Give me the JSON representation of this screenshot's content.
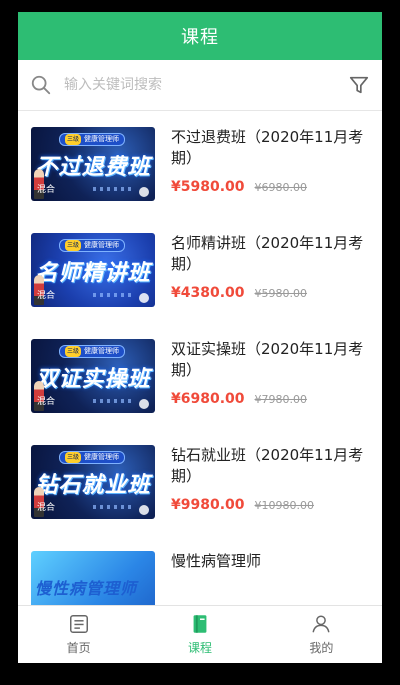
{
  "header": {
    "title": "课程"
  },
  "search": {
    "placeholder": "输入关键词搜索",
    "value": ""
  },
  "courses": [
    {
      "title": "不过退费班（2020年11月考期）",
      "price": "¥5980.00",
      "original_price": "¥6980.00",
      "thumb": {
        "badge_tag": "三级",
        "badge": "健康管理师",
        "big": "不过退费班",
        "mix": "混合"
      }
    },
    {
      "title": "名师精讲班（2020年11月考期）",
      "price": "¥4380.00",
      "original_price": "¥5980.00",
      "thumb": {
        "badge_tag": "三级",
        "badge": "健康管理师",
        "big": "名师精讲班",
        "mix": "混合"
      }
    },
    {
      "title": "双证实操班（2020年11月考期）",
      "price": "¥6980.00",
      "original_price": "¥7980.00",
      "thumb": {
        "badge_tag": "三级",
        "badge": "健康管理师",
        "big": "双证实操班",
        "mix": "混合"
      }
    },
    {
      "title": "钻石就业班（2020年11月考期）",
      "price": "¥9980.00",
      "original_price": "¥10980.00",
      "thumb": {
        "badge_tag": "三级",
        "badge": "健康管理师",
        "big": "钻石就业班",
        "mix": "混合"
      }
    },
    {
      "title": "慢性病管理师",
      "price": "",
      "original_price": "",
      "thumb": {
        "big": "慢性病管理师"
      }
    }
  ],
  "tabs": [
    {
      "label": "首页",
      "icon": "home-list-icon"
    },
    {
      "label": "课程",
      "icon": "book-icon",
      "active": true
    },
    {
      "label": "我的",
      "icon": "user-icon"
    }
  ],
  "colors": {
    "accent": "#2dbd73",
    "price": "#f04a3a"
  }
}
